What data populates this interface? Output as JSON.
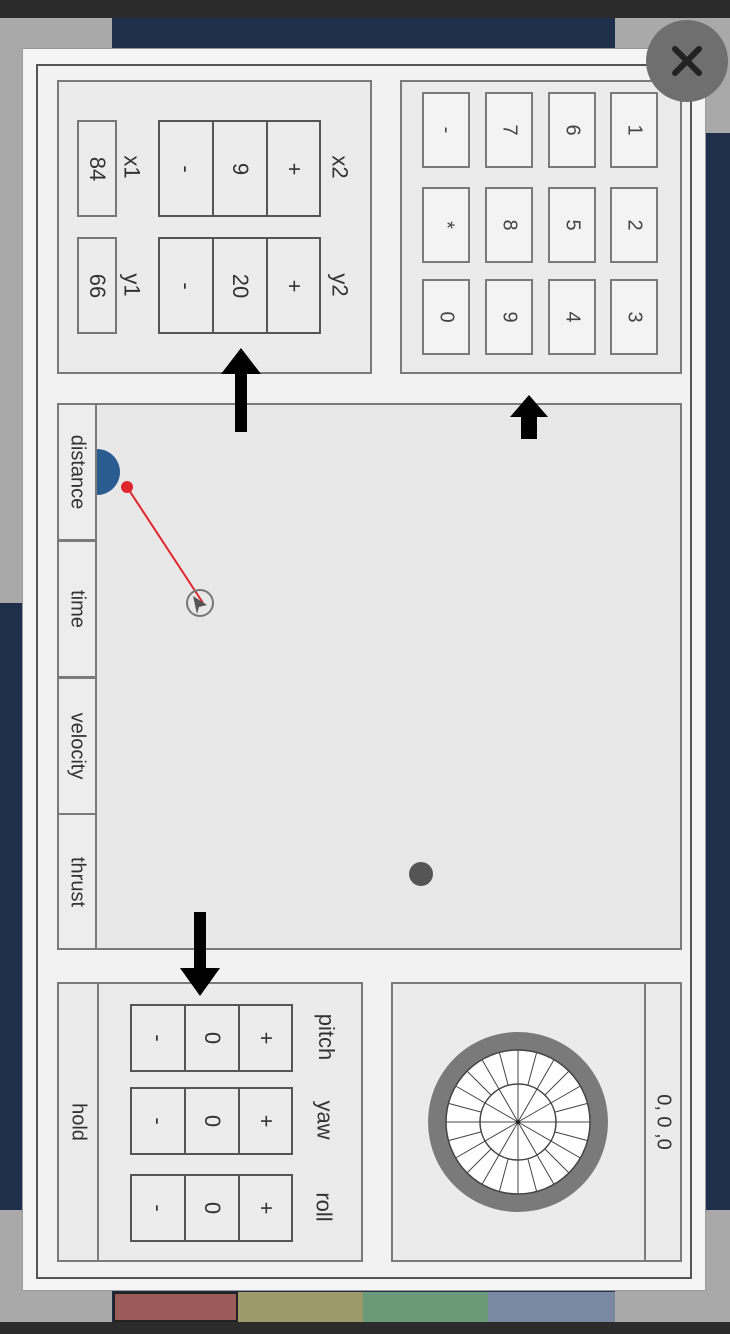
{
  "numpad": {
    "keys": [
      {
        "label": "1"
      },
      {
        "label": "2"
      },
      {
        "label": "3"
      },
      {
        "label": "6"
      },
      {
        "label": "5"
      },
      {
        "label": "4"
      },
      {
        "label": "7"
      },
      {
        "label": "8"
      },
      {
        "label": "9"
      },
      {
        "label": "-"
      },
      {
        "label": "*"
      },
      {
        "label": "0"
      }
    ]
  },
  "coords": {
    "x2_label": "x2",
    "y2_label": "y2",
    "x1_label": "x1",
    "y1_label": "y1",
    "x2_value": "9",
    "y2_value": "20",
    "x1_value": "84",
    "y1_value": "66",
    "plus": "+",
    "minus": "-"
  },
  "tabs": {
    "distance": "distance",
    "time": "time",
    "velocity": "velocity",
    "thrust": "thrust"
  },
  "attitude": {
    "pitch_label": "pitch",
    "yaw_label": "yaw",
    "roll_label": "roll",
    "pitch_value": "0",
    "yaw_value": "0",
    "roll_value": "0",
    "plus": "+",
    "minus": "-",
    "hold_label": "hold"
  },
  "gauge": {
    "readout": "0, 0 ,0"
  },
  "colors": {
    "swatches": [
      "#9c5b5b",
      "#9c9a68",
      "#6b9a78",
      "#7a88a2"
    ],
    "planet": "#2a5d8f",
    "target": "#e0262d",
    "body": "#555555"
  },
  "close": {
    "icon": "close-icon"
  }
}
